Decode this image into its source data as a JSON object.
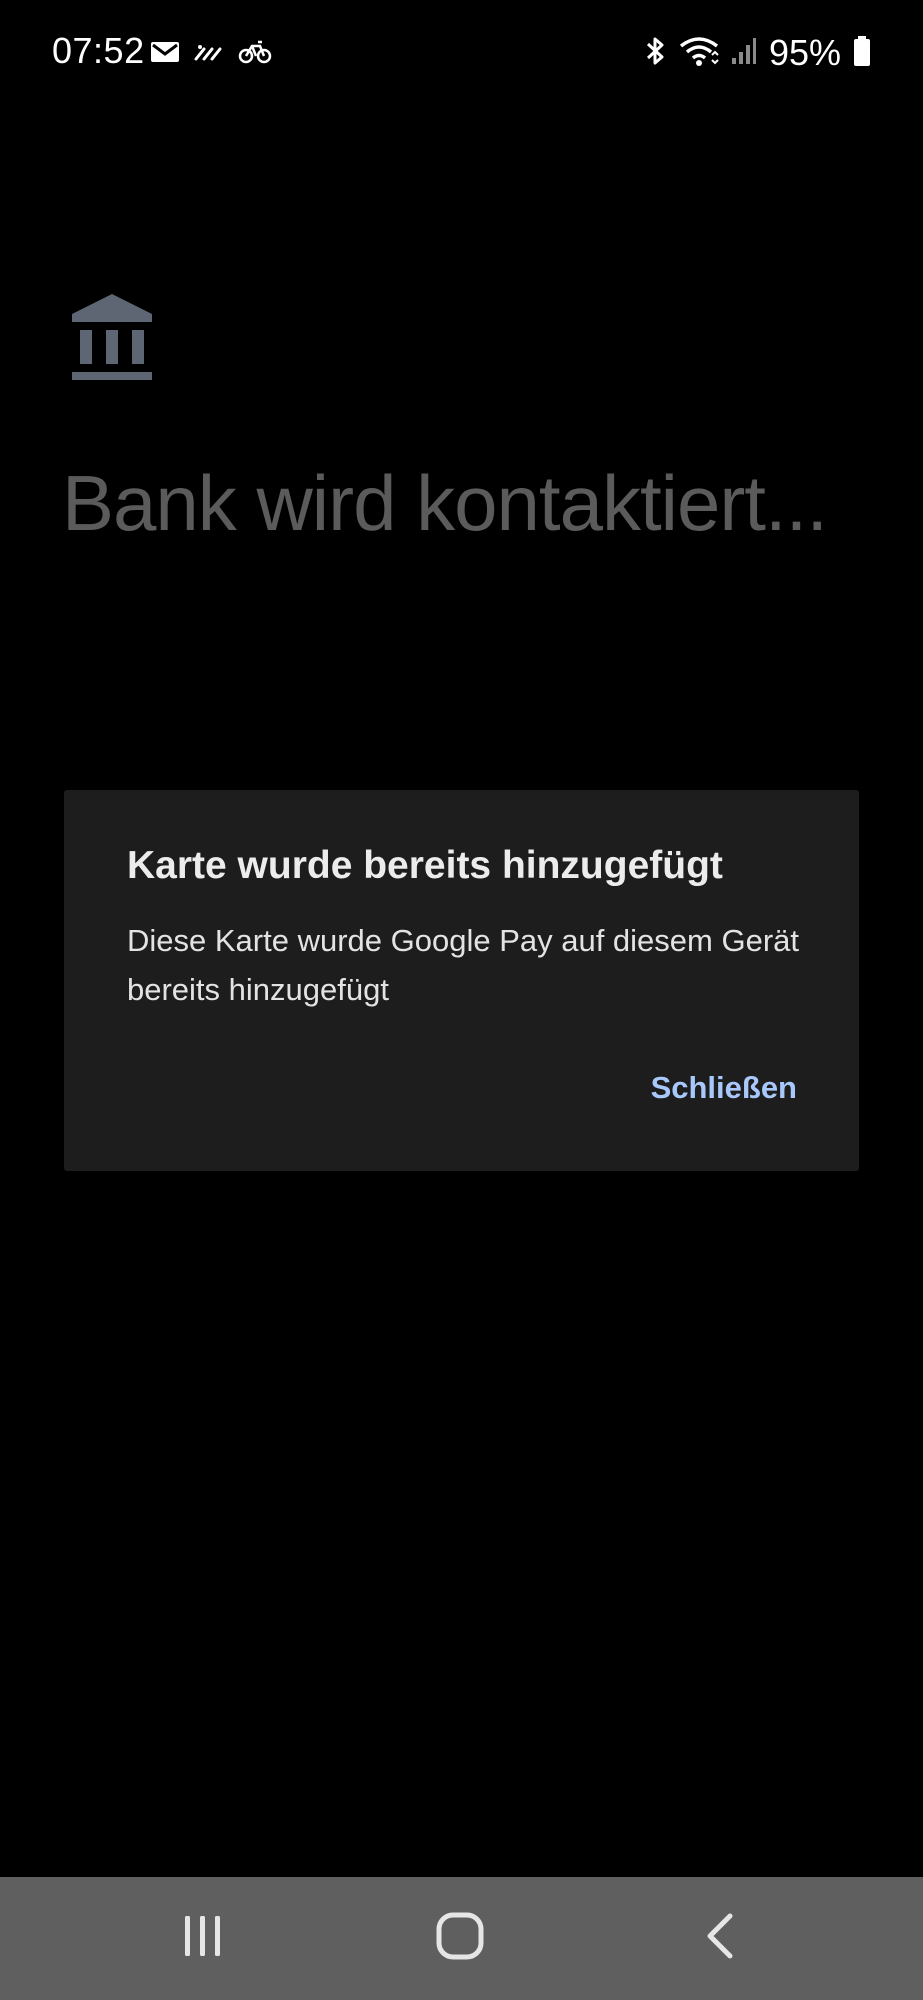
{
  "status_bar": {
    "time": "07:52",
    "battery_percent": "95%",
    "left_icons": [
      "email-icon",
      "signal-waves-icon",
      "bicycle-icon"
    ],
    "right_icons": [
      "bluetooth-icon",
      "wifi-icon",
      "cell-signal-icon",
      "battery-icon"
    ]
  },
  "screen": {
    "icon": "bank-icon",
    "loading_title": "Bank wird kontaktiert..."
  },
  "dialog": {
    "title": "Karte wurde bereits hinzugefügt",
    "message": "Diese Karte wurde Google Pay auf diesem Gerät bereits hinzugefügt",
    "close_label": "Schließen"
  },
  "navigation_bar": {
    "buttons": [
      "recents-icon",
      "home-icon",
      "back-icon"
    ]
  },
  "colors": {
    "background": "#000000",
    "dialog_background": "#1d1d1d",
    "accent": "#a8c7fa",
    "muted_title": "#5b5b5b",
    "icon_gray": "#5f6673",
    "nav_bar": "#5f5f5f"
  }
}
